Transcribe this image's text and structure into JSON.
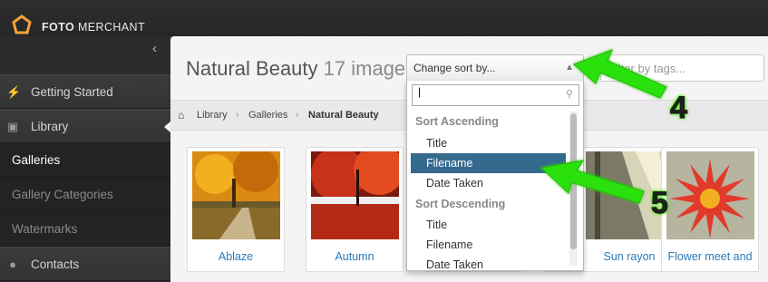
{
  "app": {
    "brand_bold": "FOTO",
    "brand_rest": "MERCHANT",
    "collapse_icon": "chevron-left-icon"
  },
  "sidebar": {
    "items": [
      {
        "label": "Getting Started",
        "icon": "bolt-icon",
        "kind": "section"
      },
      {
        "label": "Library",
        "icon": "image-icon",
        "kind": "section"
      },
      {
        "label": "Galleries",
        "kind": "sub",
        "active": true
      },
      {
        "label": "Gallery Categories",
        "kind": "sub"
      },
      {
        "label": "Watermarks",
        "kind": "sub"
      },
      {
        "label": "Contacts",
        "icon": "user-icon",
        "kind": "section"
      }
    ]
  },
  "main": {
    "title": "Natural Beauty",
    "count": "17 images",
    "filter_placeholder": "Filter by tags...",
    "breadcrumb": [
      "Library",
      "Galleries",
      "Natural Beauty"
    ]
  },
  "sort": {
    "label": "Change sort by...",
    "groups": [
      {
        "label": "Sort Ascending",
        "options": [
          "Title",
          "Filename",
          "Date Taken"
        ]
      },
      {
        "label": "Sort Descending",
        "options": [
          "Title",
          "Filename",
          "Date Taken"
        ]
      }
    ],
    "highlighted": "Filename"
  },
  "gallery": [
    {
      "caption": "Ablaze"
    },
    {
      "caption": "Autumn"
    },
    {
      "caption": ""
    },
    {
      "caption": ""
    },
    {
      "caption": "Sun rayon"
    },
    {
      "caption": "Flower meet and"
    }
  ],
  "annotations": {
    "step_a": "4",
    "step_b": "5",
    "arrow_color": "#2be00f"
  },
  "colors": {
    "accent": "#2a7ab8",
    "highlight": "#356a8f",
    "logo": "#f2a33a"
  }
}
